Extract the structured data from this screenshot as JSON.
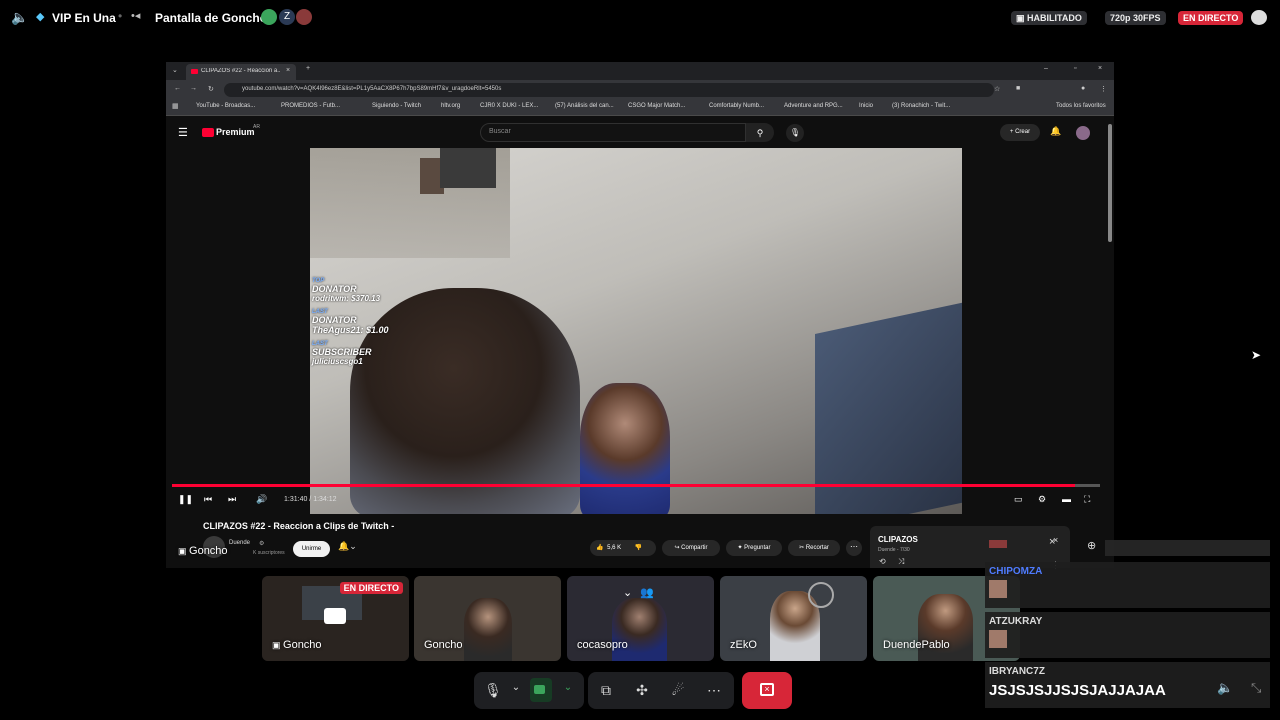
{
  "topbar": {
    "channel_name": "VIP En Una",
    "stream_title": "Pantalla de Goncho",
    "enabled_label": "HABILITADO",
    "quality_label": "720p 30FPS",
    "live_label": "EN DIRECTO"
  },
  "browser": {
    "tab_title": "CLIPAZOS #22 - Reaccion a...",
    "url": "youtube.com/watch?v=AQK4I96ez8E&list=PL1y5AaCX8P67h7bpS89mHf7&v_uragdoeRIt=5450s",
    "bookmarks": [
      "YouTube - Broadcas...",
      "PROMEDIOS - Futb...",
      "Siguiendo - Twitch",
      "hltv.org",
      "CJR0 X DUKI - LEX...",
      "(57) Análisis del can...",
      "CSGO Major Match...",
      "Comfortably Numb...",
      "Adventure and RPG...",
      "Inicio",
      "(3) Ronachich - Twit..."
    ],
    "bookmarks_all": "Todos los favoritos"
  },
  "youtube": {
    "logo_label": "Premium",
    "logo_region": "AR",
    "search_placeholder": "Buscar",
    "create_label": "Crear",
    "video_title": "CLIPAZOS #22 - Reaccion a Clips de Twitch -",
    "channel": "Duende",
    "subscribers": "K suscriptores",
    "join_label": "Unirme",
    "likes": "5,6 K",
    "share_label": "Compartir",
    "ask_label": "Preguntar",
    "clip_label": "Recortar",
    "time": "1:31:40 / 1:34:12",
    "progress": 0.973,
    "playlist_title": "CLIPAZOS",
    "playlist_sub": "Duende - 7/30",
    "overlay_top_label": "TOP",
    "overlay_donator": "DONATOR",
    "overlay_top_donor": "rodritwm: $370.13",
    "overlay_last_label": "LAST",
    "overlay_last_donor": "TheAgus21: $1.00",
    "overlay_last_sub_label": "LAST",
    "overlay_subscriber": "SUBSCRIBER",
    "overlay_last_sub": "juliciuscsgo1"
  },
  "presenter_label": "Goncho",
  "participants": [
    {
      "name": "Goncho",
      "live": "EN DIRECTO",
      "bg": "#2a2420"
    },
    {
      "name": "Goncho",
      "bg": "#3a3530"
    },
    {
      "name": "cocasopro",
      "bg": "#2b2a33"
    },
    {
      "name": "zEkO",
      "bg": "#3b3f45"
    },
    {
      "name": "DuendePablo",
      "bg": "#4a5a55"
    }
  ],
  "chat": {
    "messages": [
      {
        "user": "CHIPOMZA",
        "color": "#4f7cff",
        "text": ""
      },
      {
        "user": "ATZUKRAY",
        "color": "#ddd",
        "text": ""
      },
      {
        "user": "IBRYANC7Z",
        "color": "#ddd",
        "text": "JSJSJSJJSJSJAJJAJAA"
      }
    ]
  },
  "colors": {
    "live_red": "#d72638",
    "end_call_red": "#d72638",
    "yt_red": "#ff0033"
  }
}
